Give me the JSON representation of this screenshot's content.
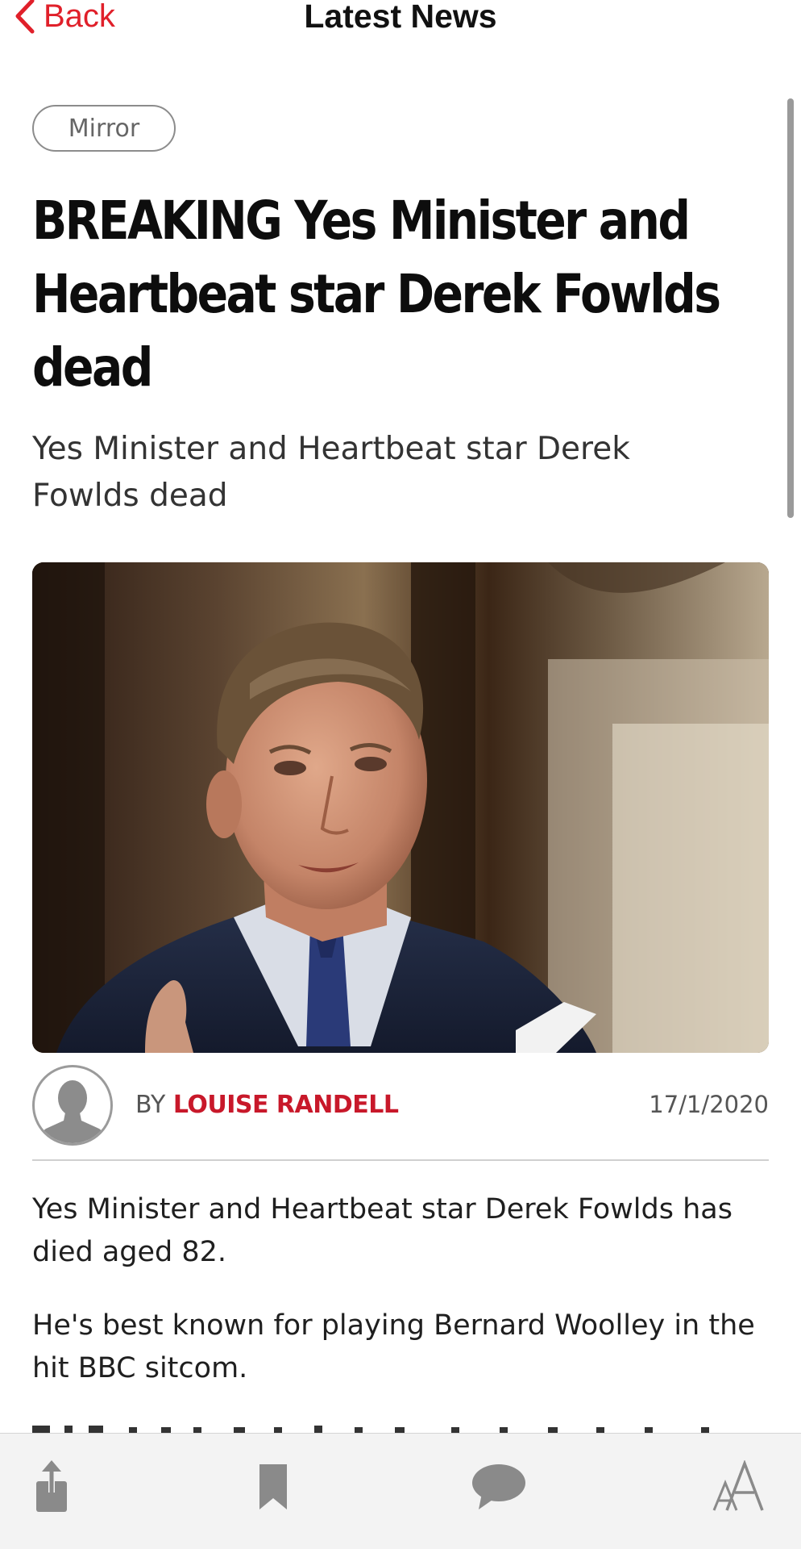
{
  "nav": {
    "back_label": "Back",
    "title": "Latest News"
  },
  "article": {
    "source": "Mirror",
    "headline": "BREAKING Yes Minister and Heartbeat star Derek Fowlds dead",
    "subheadline": "Yes Minister and Heartbeat star Derek Fowlds dead",
    "byline_prefix": "BY",
    "author": "LOUISE RANDELL",
    "date": "17/1/2020",
    "paragraphs": [
      "Yes Minister and Heartbeat star Derek Fowlds has died aged 82.",
      "He's best known for playing Bernard Woolley in the hit BBC sitcom."
    ]
  },
  "toolbar": {
    "icons": [
      "share-icon",
      "bookmark-icon",
      "comment-icon",
      "text-size-icon"
    ]
  },
  "colors": {
    "accent": "#e0202a",
    "author": "#c8182a",
    "toolbar_bg": "#f3f3f3",
    "icon_gray": "#8a8a8a"
  }
}
